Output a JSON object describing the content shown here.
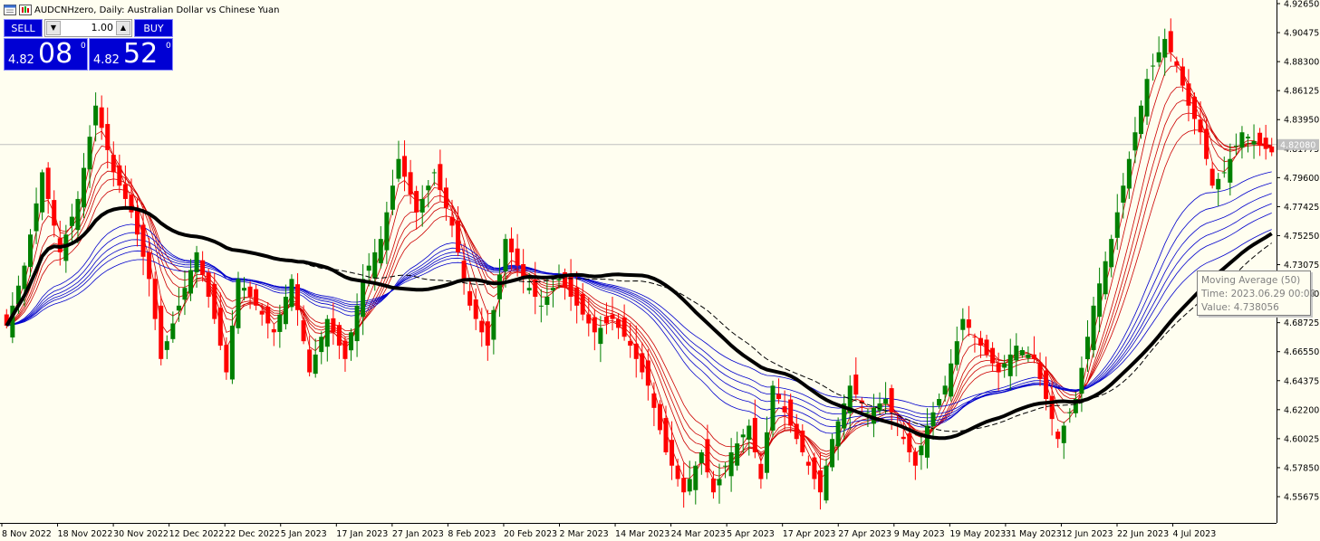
{
  "header": {
    "title": "AUDCNHzero, Daily:  Australian Dollar vs Chinese Yuan"
  },
  "trade_panel": {
    "sell_label": "SELL",
    "buy_label": "BUY",
    "lot_value": "1.00",
    "bid": {
      "small": "4.82",
      "big": "08",
      "sup": "0"
    },
    "ask": {
      "small": "4.82",
      "big": "52",
      "sup": "0"
    }
  },
  "tooltip": {
    "line1": "Moving Average (50)",
    "line2": "Time: 2023.06.29 00:00",
    "line3": "Value: 4.738056"
  },
  "colors": {
    "background": "#fffef0",
    "bull_candle": "#008000",
    "bear_candle": "#ff0000",
    "short_ma": "#cc0000",
    "long_ma": "#0000cc",
    "ma50": "#000000",
    "button_blue": "#0000d4"
  },
  "chart_data": {
    "type": "candlestick",
    "symbol": "AUDCNHzero",
    "timeframe": "Daily",
    "current_price": 4.8208,
    "current_price_label": "4.82080",
    "ylim": [
      4.535,
      4.927
    ],
    "y_ticks": [
      "4.92650",
      "4.90475",
      "4.88300",
      "4.86125",
      "4.83950",
      "4.81775",
      "4.79600",
      "4.77425",
      "4.75250",
      "4.73075",
      "4.70900",
      "4.68725",
      "4.66550",
      "4.64375",
      "4.62200",
      "4.60025",
      "4.57850",
      "4.55675"
    ],
    "x_ticks": [
      "8 Nov 2022",
      "18 Nov 2022",
      "30 Nov 2022",
      "12 Dec 2022",
      "22 Dec 2022",
      "5 Jan 2023",
      "17 Jan 2023",
      "27 Jan 2023",
      "8 Feb 2023",
      "20 Feb 2023",
      "2 Mar 2023",
      "14 Mar 2023",
      "24 Mar 2023",
      "5 Apr 2023",
      "17 Apr 2023",
      "27 Apr 2023",
      "9 May 2023",
      "19 May 2023",
      "31 May 2023",
      "12 Jun 2023",
      "22 Jun 2023",
      "4 Jul 2023"
    ],
    "indicators": [
      {
        "name": "Moving Average (50)",
        "at": "2023.06.29 00:00",
        "value": 4.738056
      }
    ]
  }
}
